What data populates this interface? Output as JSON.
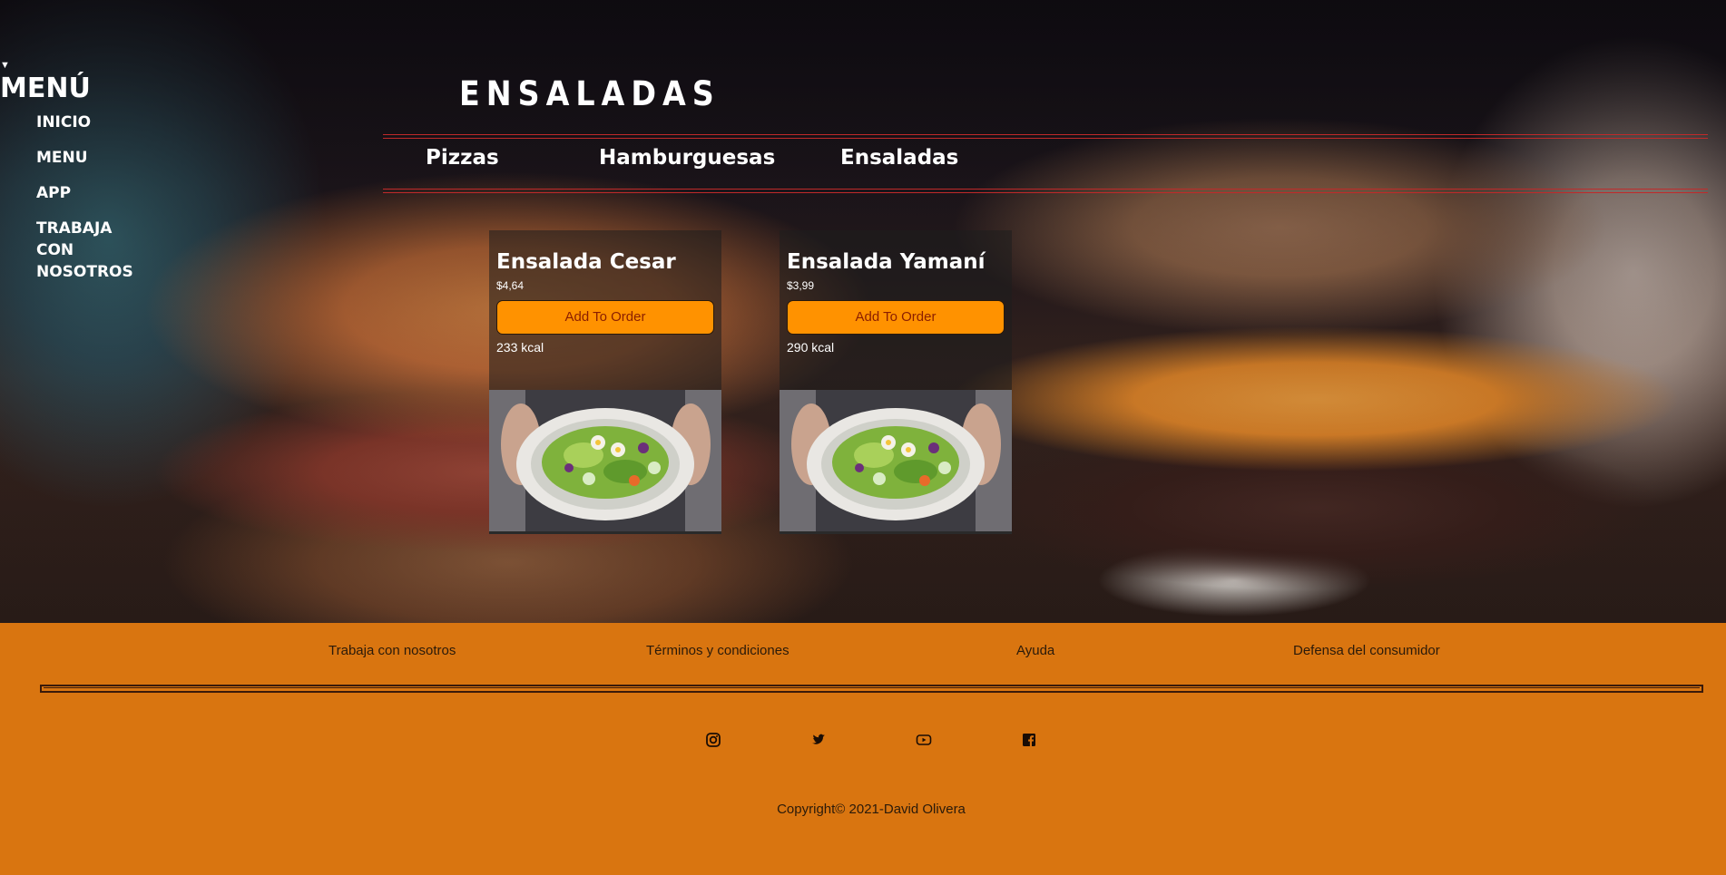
{
  "sidebar": {
    "toggle_glyph": "▼",
    "title": "MENÚ",
    "items": [
      {
        "label": "INICIO"
      },
      {
        "label": "MENU"
      },
      {
        "label": "APP"
      },
      {
        "label_lines": [
          "TRABAJA",
          "CON",
          "NOSOTROS"
        ]
      }
    ]
  },
  "page": {
    "title": "ENSALADAS"
  },
  "tabs": [
    {
      "label": "Pizzas"
    },
    {
      "label": "Hamburguesas"
    },
    {
      "label": "Ensaladas"
    }
  ],
  "products": [
    {
      "name": "Ensalada Cesar",
      "price": "$4,64",
      "button_label": "Add To Order",
      "kcal": "233 kcal"
    },
    {
      "name": "Ensalada Yamaní",
      "price": "$3,99",
      "button_label": "Add To Order",
      "kcal": "290 kcal"
    }
  ],
  "footer": {
    "links": [
      {
        "label": "Trabaja con nosotros"
      },
      {
        "label": "Términos y condiciones"
      },
      {
        "label": "Ayuda"
      },
      {
        "label": "Defensa del consumidor"
      }
    ],
    "social_icons": [
      "instagram-icon",
      "twitter-icon",
      "youtube-icon",
      "facebook-icon"
    ],
    "copyright": "Copyright© 2021-David Olivera"
  },
  "colors": {
    "accent_orange": "#ff9200",
    "footer_background": "#d97510",
    "tab_rule_red": "#c02a2a"
  }
}
